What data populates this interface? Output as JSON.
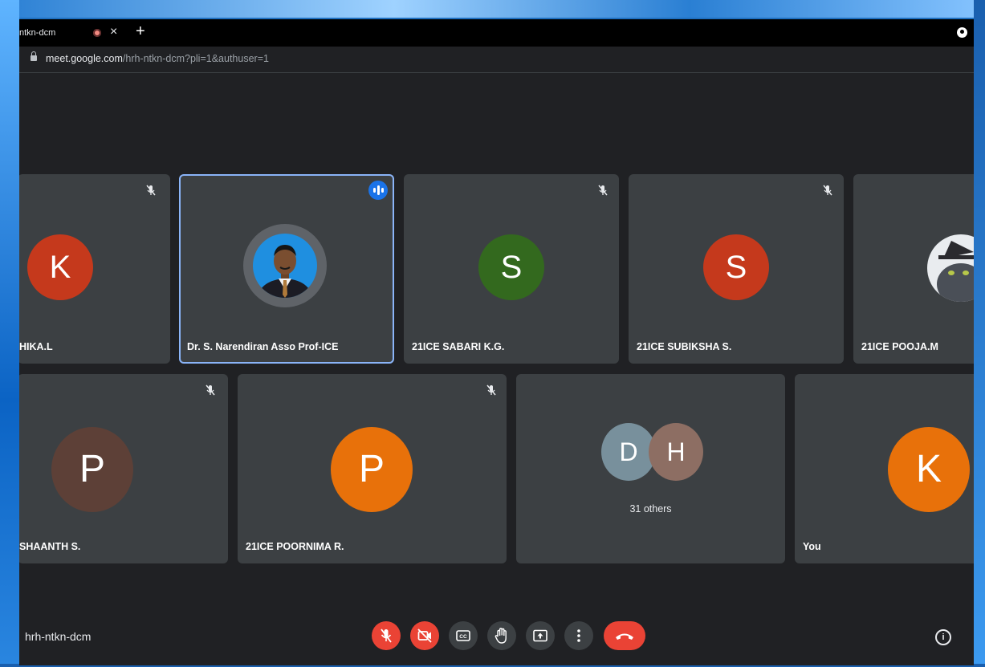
{
  "browser": {
    "tab_title": "ntkn-dcm",
    "tab_close": "×",
    "new_tab": "+",
    "url_host": "meet.google.com",
    "url_path": "/hrh-ntkn-dcm?pli=1&authuser=1"
  },
  "tiles_row1": [
    {
      "name": "HIKA.L",
      "initial": "K",
      "avatar_color": "#c5391c",
      "muted": true
    },
    {
      "name": "Dr. S. Narendiran Asso Prof-ICE",
      "initial": "",
      "avatar_type": "photo",
      "speaking": true,
      "active": true
    },
    {
      "name": "21ICE SABARI K.G.",
      "initial": "S",
      "avatar_color": "#33691e",
      "muted": true
    },
    {
      "name": "21ICE SUBIKSHA S.",
      "initial": "S",
      "avatar_color": "#c5391c",
      "muted": true
    },
    {
      "name": "21ICE POOJA.M",
      "initial": "",
      "avatar_type": "photo",
      "muted": false
    }
  ],
  "tiles_row2": [
    {
      "name": "SHAANTH S.",
      "initial": "P",
      "avatar_color": "#5d4037",
      "muted": true
    },
    {
      "name": "21ICE POORNIMA R.",
      "initial": "P",
      "avatar_color": "#e8710a",
      "muted": true
    },
    {
      "others_label": "31 others",
      "initials": [
        "D",
        "H"
      ],
      "colors": [
        "#78909c",
        "#8d6e63"
      ]
    },
    {
      "name": "You",
      "initial": "K",
      "avatar_color": "#e8710a",
      "muted": false
    }
  ],
  "bottom_bar": {
    "meeting_code": "hrh-ntkn-dcm",
    "controls": [
      "mic-off",
      "camera-off",
      "captions",
      "raise-hand",
      "present-screen",
      "more-options",
      "leave-call"
    ],
    "info": "i"
  }
}
